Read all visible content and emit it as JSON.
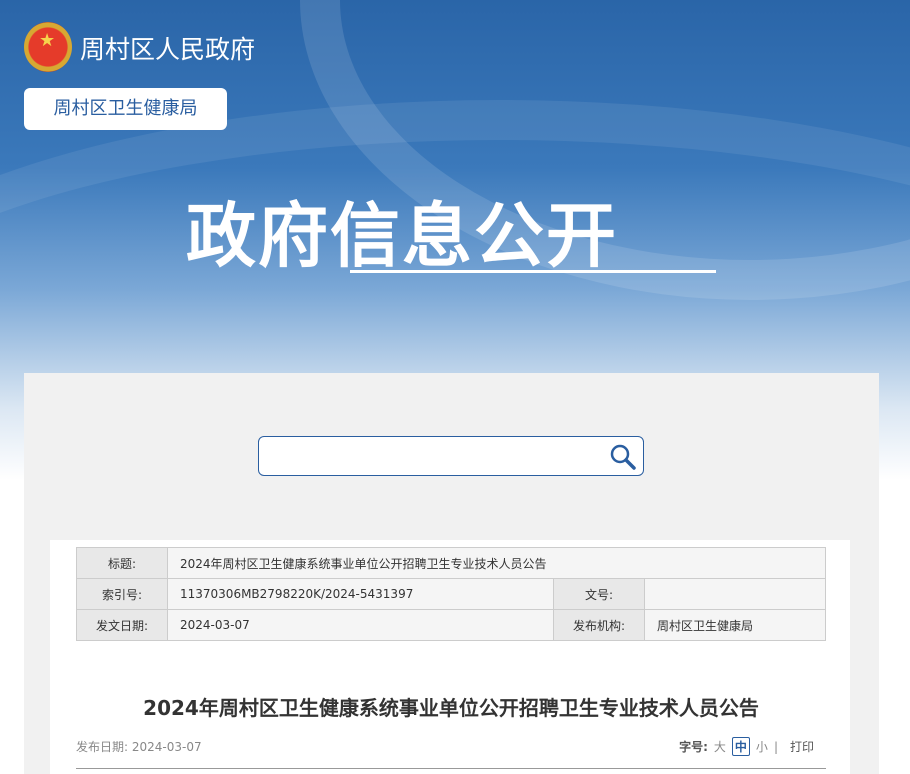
{
  "header": {
    "gov_name": "周村区人民政府",
    "dept_name": "周村区卫生健康局",
    "banner_title": "政府信息公开"
  },
  "search": {
    "placeholder": "",
    "icon": "search-icon"
  },
  "info_table": {
    "title_label": "标题:",
    "title_value": "2024年周村区卫生健康系统事业单位公开招聘卫生专业技术人员公告",
    "index_label": "索引号:",
    "index_value": "11370306MB2798220K/2024-5431397",
    "docno_label": "文号:",
    "docno_value": "",
    "date_label": "发文日期:",
    "date_value": "2024-03-07",
    "org_label": "发布机构:",
    "org_value": "周村区卫生健康局"
  },
  "article": {
    "title": "2024年周村区卫生健康系统事业单位公开招聘卫生专业技术人员公告",
    "publish_date": "发布日期: 2024-03-07"
  },
  "tools": {
    "font_label": "字号:",
    "large": "大",
    "medium": "中",
    "small": "小",
    "sep": "|",
    "print": "打印"
  },
  "colors": {
    "brand": "#2a5ea0"
  }
}
